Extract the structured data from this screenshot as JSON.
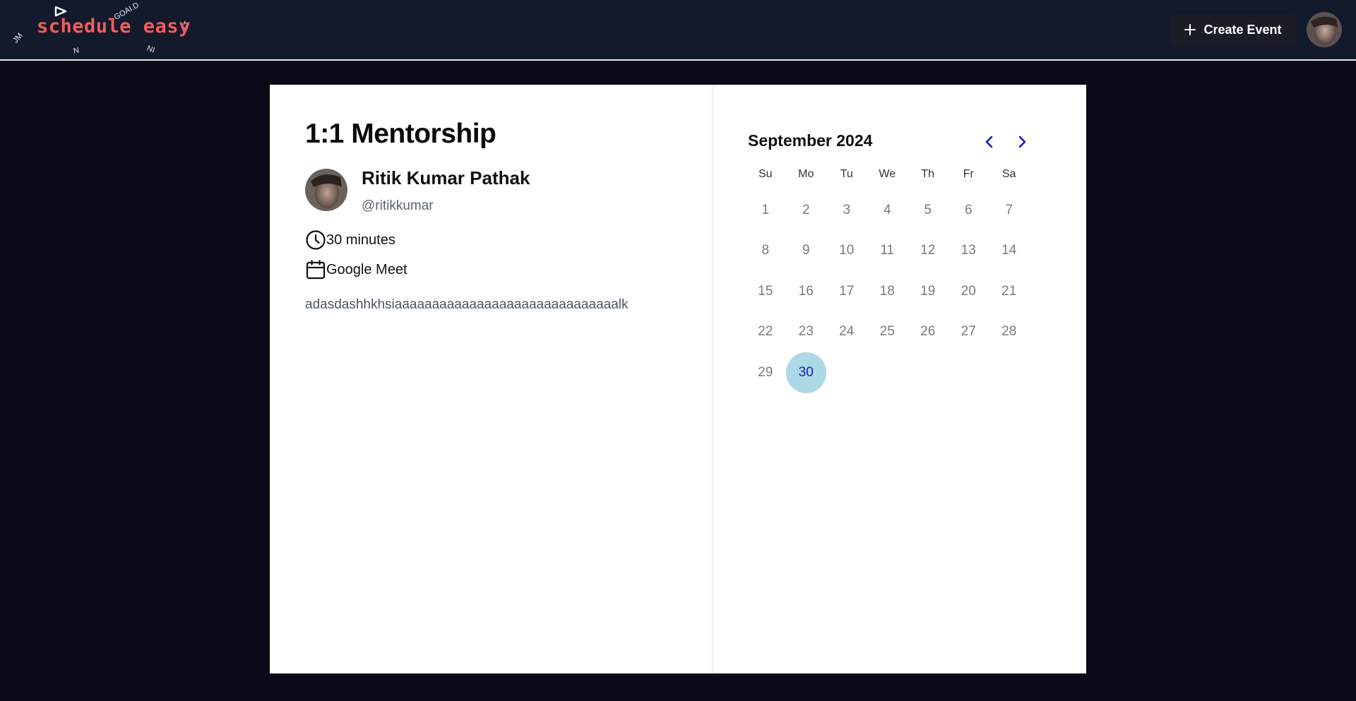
{
  "header": {
    "logo_text": "schedule easy",
    "logo_fragments": [
      "GOAI.D",
      "LT",
      "JM",
      "N",
      "NI"
    ],
    "create_event_label": "Create Event"
  },
  "event": {
    "title": "1:1 Mentorship",
    "host_name": "Ritik Kumar Pathak",
    "host_handle": "@ritikkumar",
    "duration": "30 minutes",
    "location": "Google Meet",
    "description": "adasdashhkhsiaaaaaaaaaaaaaaaaaaaaaaaaaaaaaalk"
  },
  "calendar": {
    "month_label": "September 2024",
    "weekdays": [
      "Su",
      "Mo",
      "Tu",
      "We",
      "Th",
      "Fr",
      "Sa"
    ],
    "weeks": [
      [
        "1",
        "2",
        "3",
        "4",
        "5",
        "6",
        "7"
      ],
      [
        "8",
        "9",
        "10",
        "11",
        "12",
        "13",
        "14"
      ],
      [
        "15",
        "16",
        "17",
        "18",
        "19",
        "20",
        "21"
      ],
      [
        "22",
        "23",
        "24",
        "25",
        "26",
        "27",
        "28"
      ],
      [
        "29",
        "30",
        "",
        "",
        "",
        "",
        ""
      ]
    ],
    "selected_day": "30",
    "accent_color": "#1a1acc",
    "selected_bg": "#add8e6"
  },
  "icons": {
    "create": "plus-icon",
    "duration": "clock-icon",
    "location": "calendar-icon",
    "prev": "chevron-left-icon",
    "next": "chevron-right-icon"
  }
}
